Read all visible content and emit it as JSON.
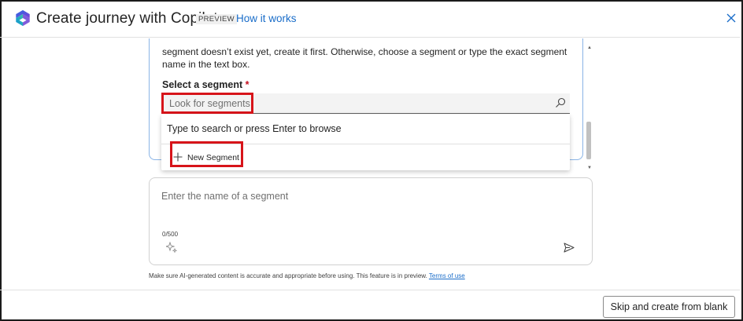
{
  "header": {
    "title": "Create journey with Copilot",
    "badge": "PREVIEW",
    "help_link": "How it works"
  },
  "card": {
    "intro_text": "segment doesn’t exist yet, create it first. Otherwise, choose a segment or type the exact segment name in the text box.",
    "field_label": "Select a segment",
    "required_marker": "*",
    "search_placeholder": "Look for segments",
    "dropdown_hint": "Type to search or press Enter to browse",
    "new_segment_label": "New Segment"
  },
  "prompt": {
    "placeholder": "Enter the name of a segment",
    "char_count": "0/500"
  },
  "disclaimer": {
    "text": "Make sure AI-generated content is accurate and appropriate before using. This feature is in preview.",
    "link": "Terms of use"
  },
  "footer": {
    "skip_button": "Skip and create from blank"
  },
  "colors": {
    "accent": "#1a6dc9",
    "highlight": "#d7141a",
    "required": "#c50f1f"
  },
  "icons": [
    "copilot-logo-icon",
    "close-icon",
    "search-icon",
    "plus-icon",
    "sparkle-icon",
    "send-icon"
  ]
}
